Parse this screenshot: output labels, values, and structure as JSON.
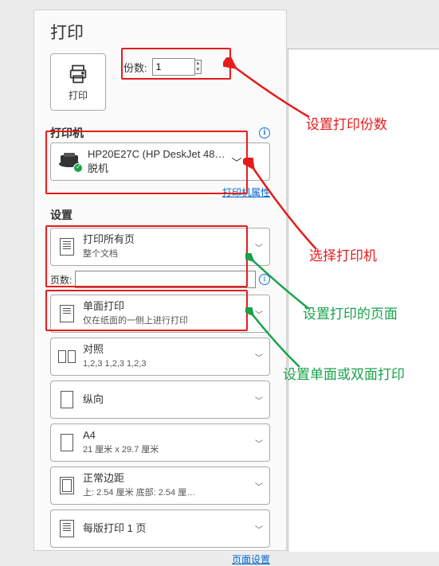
{
  "title": "打印",
  "printBtnLabel": "打印",
  "copies": {
    "label": "份数:",
    "value": "1"
  },
  "printerSection": "打印机",
  "printer": {
    "name": "HP20E27C (HP DeskJet 48…",
    "status": "脱机"
  },
  "printerPropsLink": "打印机属性",
  "settingsSection": "设置",
  "opts": {
    "scope": {
      "l1": "打印所有页",
      "l2": "整个文档"
    },
    "pagesLabel": "页数:",
    "sides": {
      "l1": "单面打印",
      "l2": "仅在纸面的一侧上进行打印"
    },
    "collate": {
      "l1": "对照",
      "l2": "1,2,3    1,2,3    1,2,3"
    },
    "orient": {
      "l1": "纵向"
    },
    "paper": {
      "l1": "A4",
      "l2": "21 厘米 x 29.7 厘米"
    },
    "margins": {
      "l1": "正常边距",
      "l2": "上: 2.54 厘米 底部: 2.54 厘…"
    },
    "perSheet": {
      "l1": "每版打印 1 页"
    }
  },
  "pageSetupLink": "页面设置",
  "annotations": {
    "a1": "设置打印份数",
    "a2": "选择打印机",
    "a3": "设置打印的页面",
    "a4": "设置单面或双面打印"
  }
}
